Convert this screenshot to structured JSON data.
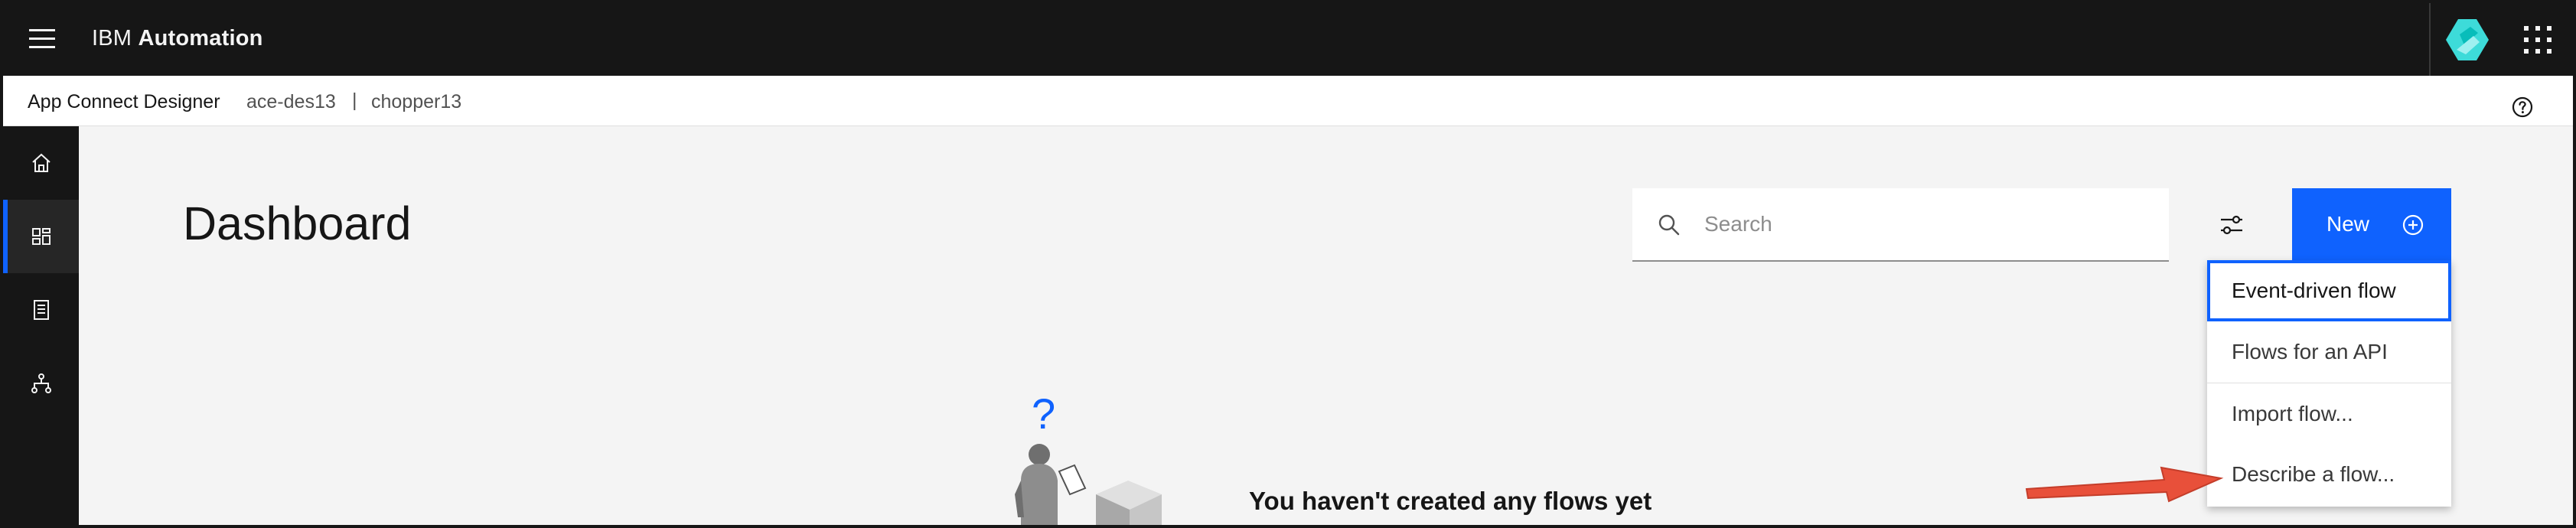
{
  "header": {
    "brand_prefix": "IBM",
    "brand_product": "Automation"
  },
  "subheader": {
    "app_name": "App Connect Designer",
    "instance": "ace-des13",
    "separator": "|",
    "namespace": "chopper13"
  },
  "siderail": {
    "items": [
      {
        "name": "home",
        "icon": "home-icon",
        "active": false
      },
      {
        "name": "dashboard",
        "icon": "dashboard-icon",
        "active": true
      },
      {
        "name": "catalog",
        "icon": "catalog-icon",
        "active": false
      },
      {
        "name": "flows",
        "icon": "hierarchy-icon",
        "active": false
      }
    ]
  },
  "main": {
    "title": "Dashboard",
    "search": {
      "placeholder": "Search",
      "value": ""
    },
    "new_button": {
      "label": "New"
    },
    "new_menu": {
      "items": [
        {
          "label": "Event-driven flow",
          "focused": true
        },
        {
          "label": "Flows for an API",
          "focused": false
        },
        {
          "label": "Import flow...",
          "focused": false
        },
        {
          "label": "Describe a flow...",
          "focused": false
        }
      ]
    },
    "empty_state": {
      "illustration_mark": "?",
      "title": "You haven't created any flows yet"
    }
  },
  "colors": {
    "header_bg": "#161616",
    "accent": "#0f62fe",
    "page_bg": "#f4f4f4",
    "annotation_arrow": "#e8503a",
    "logo_teal": "#3ddbd9"
  }
}
